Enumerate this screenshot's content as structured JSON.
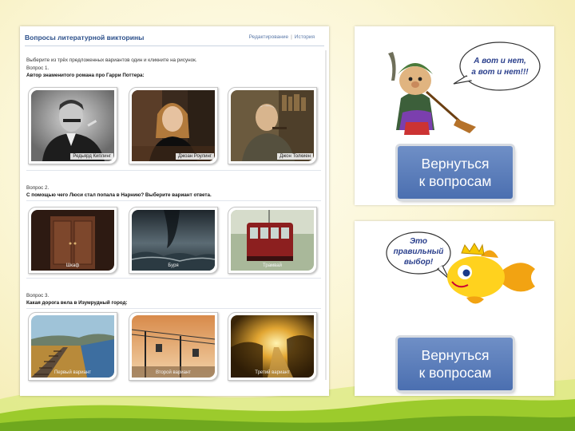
{
  "quiz": {
    "title": "Вопросы литературной викторины",
    "links": {
      "edit": "Редактирование",
      "separator": "|",
      "history": "История"
    },
    "instruction": "Выберите из трёх предложенных вариантов один и кликните на рисунок.",
    "questions": [
      {
        "label": "Вопрос 1.",
        "text": "Автор знаменитого романа про Гарри Поттера:",
        "options": [
          "Редьярд Киплинг",
          "Джоан Роулинг",
          "Джон Толкиен"
        ]
      },
      {
        "label": "Вопрос 2.",
        "text": "С помощью чего Люси стал попала в Нарнию? Выберите вариант ответа.",
        "options": [
          "Шкаф",
          "Буря",
          "Трамвай"
        ]
      },
      {
        "label": "Вопрос 3.",
        "text": "Какая дорога вела в Изумрудный город:",
        "options": [
          "Первый вариант",
          "Второй вариант",
          "Третий вариант"
        ]
      }
    ]
  },
  "feedback": {
    "wrong": {
      "bubble_line1": "А вот и нет,",
      "bubble_line2": "а вот и нет!!!",
      "button_line1": "Вернуться",
      "button_line2": "к вопросам"
    },
    "right": {
      "bubble_line1": "Это",
      "bubble_line2": "правильный",
      "bubble_line3": "выбор!",
      "button_line1": "Вернуться",
      "button_line2": "к вопросам"
    }
  },
  "colors": {
    "button": "#5b7dbb",
    "quiz_title": "#2b4f8a",
    "background_wave": "#8bbf2a"
  }
}
